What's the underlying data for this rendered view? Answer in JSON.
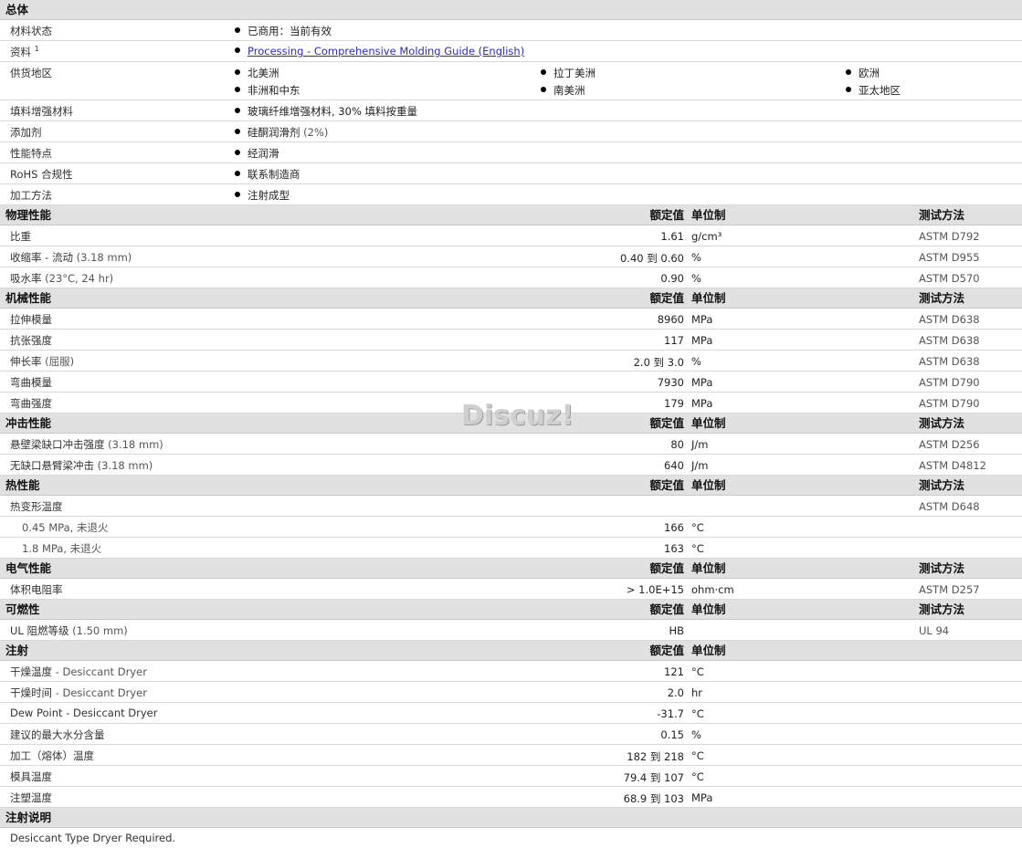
{
  "general": {
    "title": "总体",
    "status_label": "材料状态",
    "status_value": "已商用：当前有效",
    "doc_label": "资料",
    "doc_sup": "1",
    "doc_link": "Processing - Comprehensive Molding Guide (English)",
    "regions_label": "供货地区",
    "regions": [
      "北美洲",
      "拉丁美洲",
      "欧洲",
      "非洲和中东",
      "南美洲",
      "亚太地区"
    ],
    "filler_label": "填料增强材料",
    "filler_value": "玻璃纤维增强材料, 30% 填料按重量",
    "additive_label": "添加剂",
    "additive_value": "硅酮润滑剂",
    "additive_pct": "(2%)",
    "features_label": "性能特点",
    "features_value": "经润滑",
    "rohs_label": "RoHS 合规性",
    "rohs_value": "联系制造商",
    "process_label": "加工方法",
    "process_value": "注射成型"
  },
  "headers": {
    "nominal": "额定值",
    "unit": "单位制",
    "method": "测试方法"
  },
  "physical": {
    "title": "物理性能",
    "rows": [
      {
        "label": "比重",
        "cond": "",
        "value": "1.61",
        "unit": "g/cm³",
        "method": "ASTM D792"
      },
      {
        "label": "收缩率  - 流动",
        "cond": "(3.18 mm)",
        "value": "0.40 到  0.60",
        "unit": "%",
        "method": "ASTM D955"
      },
      {
        "label": "吸水率",
        "cond": "(23°C, 24 hr)",
        "value": "0.90",
        "unit": "%",
        "method": "ASTM D570"
      }
    ]
  },
  "mechanical": {
    "title": "机械性能",
    "rows": [
      {
        "label": "拉伸模量",
        "cond": "",
        "value": "8960",
        "unit": "MPa",
        "method": "ASTM D638"
      },
      {
        "label": "抗张强度",
        "cond": "",
        "value": "117",
        "unit": "MPa",
        "method": "ASTM D638"
      },
      {
        "label": "伸长率",
        "cond": "(屈服)",
        "value": "2.0 到  3.0",
        "unit": "%",
        "method": "ASTM D638"
      },
      {
        "label": "弯曲模量",
        "cond": "",
        "value": "7930",
        "unit": "MPa",
        "method": "ASTM D790"
      },
      {
        "label": "弯曲强度",
        "cond": "",
        "value": "179",
        "unit": "MPa",
        "method": "ASTM D790"
      }
    ]
  },
  "impact": {
    "title": "冲击性能",
    "rows": [
      {
        "label": "悬壁梁缺口冲击强度",
        "cond": "(3.18 mm)",
        "value": "80",
        "unit": "J/m",
        "method": "ASTM D256"
      },
      {
        "label": "无缺口悬臂梁冲击",
        "cond": "(3.18 mm)",
        "value": "640",
        "unit": "J/m",
        "method": "ASTM D4812"
      }
    ]
  },
  "thermal": {
    "title": "热性能",
    "hdt_label": "热变形温度",
    "hdt_method": "ASTM D648",
    "rows": [
      {
        "label": "0.45 MPa, 未退火",
        "value": "166",
        "unit": "°C"
      },
      {
        "label": "1.8 MPa, 未退火",
        "value": "163",
        "unit": "°C"
      }
    ]
  },
  "electrical": {
    "title": "电气性能",
    "rows": [
      {
        "label": "体积电阻率",
        "cond": "",
        "value": "> 1.0E+15",
        "unit": "ohm·cm",
        "method": "ASTM D257"
      }
    ]
  },
  "flammability": {
    "title": "可燃性",
    "rows": [
      {
        "label": "UL 阻燃等级",
        "cond": "(1.50 mm)",
        "value": "HB",
        "unit": "",
        "method": "UL 94"
      }
    ]
  },
  "injection": {
    "title": "注射",
    "rows": [
      {
        "label": "干燥温度",
        "sub": "- Desiccant Dryer",
        "value": "121",
        "unit": "°C"
      },
      {
        "label": "干燥时间",
        "sub": "- Desiccant Dryer",
        "value": "2.0",
        "unit": "hr"
      },
      {
        "label": "Dew Point - Desiccant Dryer",
        "sub": "",
        "value": "-31.7",
        "unit": "°C"
      },
      {
        "label": "建议的最大水分含量",
        "sub": "",
        "value": "0.15",
        "unit": "%"
      },
      {
        "label": "加工（熔体）温度",
        "sub": "",
        "value": "182 到  218",
        "unit": "°C"
      },
      {
        "label": "模具温度",
        "sub": "",
        "value": "79.4 到  107",
        "unit": "°C"
      },
      {
        "label": "注塑温度",
        "sub": "",
        "value": "68.9 到  103",
        "unit": "MPa"
      }
    ]
  },
  "notes": {
    "title": "注射说明",
    "text": "Desiccant Type Dryer Required."
  },
  "watermark": "Discuz!"
}
